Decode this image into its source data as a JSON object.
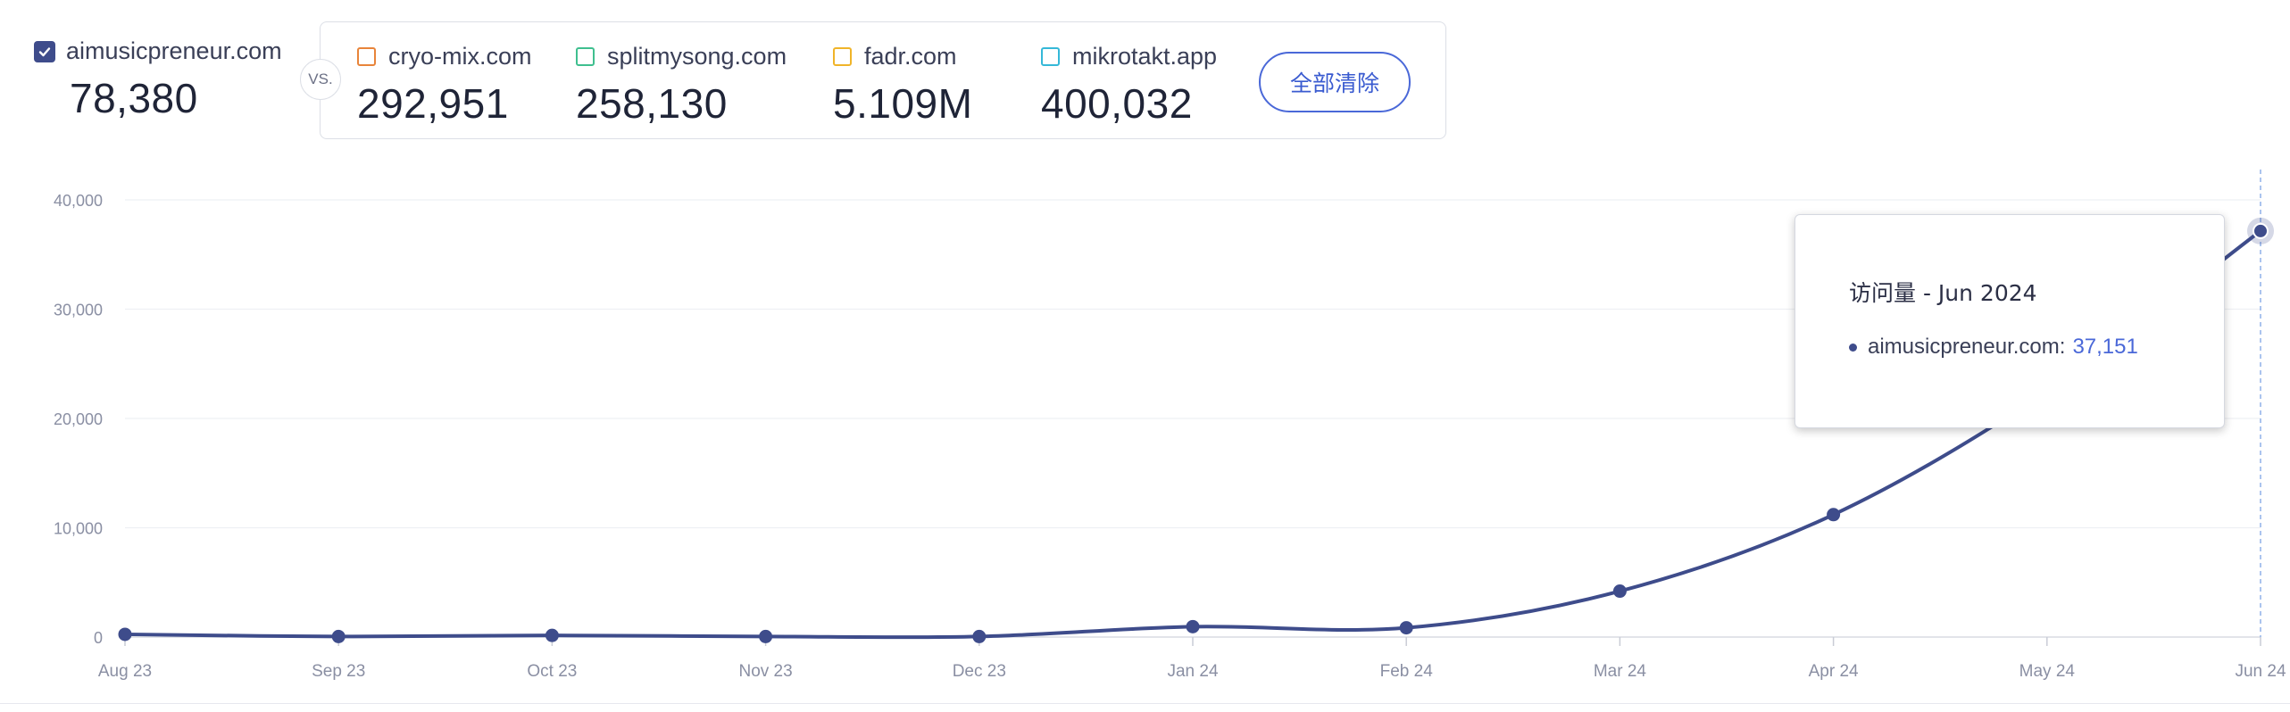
{
  "primary": {
    "site": "aimusicpreneur.com",
    "value": "78,380",
    "color": "#3e4c8b"
  },
  "vs_label": "VS.",
  "competitors": [
    {
      "site": "cryo-mix.com",
      "value": "292,951",
      "color": "#e8843a"
    },
    {
      "site": "splitmysong.com",
      "value": "258,130",
      "color": "#3fbf8f"
    },
    {
      "site": "fadr.com",
      "value": "5.109M",
      "color": "#f0b429"
    },
    {
      "site": "mikrotakt.app",
      "value": "400,032",
      "color": "#35b8d8"
    }
  ],
  "clear_all_label": "全部清除",
  "tooltip": {
    "title": "访问量 - Jun 2024",
    "site": "aimusicpreneur.com:",
    "value": "37,151"
  },
  "chart_data": {
    "type": "line",
    "categories": [
      "Aug 23",
      "Sep 23",
      "Oct 23",
      "Nov 23",
      "Dec 23",
      "Jan 24",
      "Feb 24",
      "Mar 24",
      "Apr 24",
      "May 24",
      "Jun 24"
    ],
    "series": [
      {
        "name": "aimusicpreneur.com",
        "color": "#3e4c8b",
        "values": [
          250,
          50,
          150,
          50,
          50,
          950,
          850,
          4200,
          11200,
          22500,
          37151
        ]
      }
    ],
    "ylim": [
      0,
      40000
    ],
    "yticks": [
      0,
      10000,
      20000,
      30000,
      40000
    ],
    "ytick_labels": [
      "0",
      "10,000",
      "20,000",
      "30,000",
      "40,000"
    ],
    "grid": true,
    "highlighted_category": "Jun 24"
  }
}
